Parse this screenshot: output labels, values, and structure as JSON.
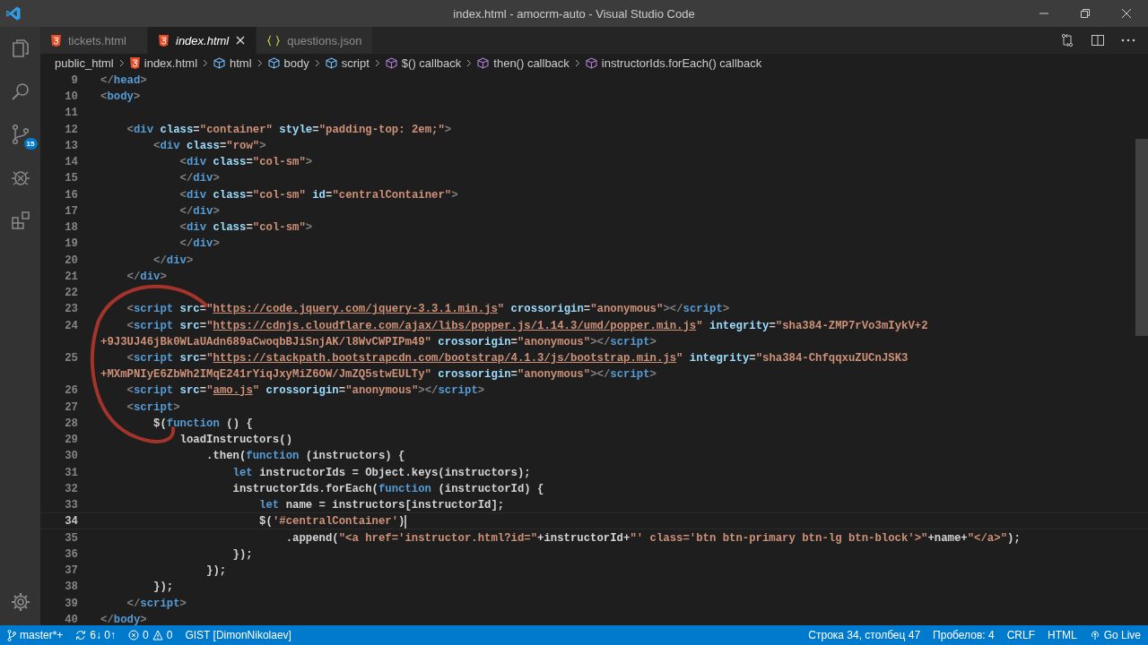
{
  "window": {
    "title": "index.html - amocrm-auto - Visual Studio Code"
  },
  "activity_bar": {
    "source_control_badge": "15"
  },
  "tabs": [
    {
      "label": "tickets.html",
      "kind": "html",
      "selected": false
    },
    {
      "label": "index.html",
      "kind": "html",
      "selected": true
    },
    {
      "label": "questions.json",
      "kind": "json",
      "selected": false
    }
  ],
  "breadcrumb": [
    {
      "label": "public_html",
      "kind": "folder"
    },
    {
      "label": "index.html",
      "kind": "html"
    },
    {
      "label": "html",
      "kind": "element"
    },
    {
      "label": "body",
      "kind": "element"
    },
    {
      "label": "script",
      "kind": "element"
    },
    {
      "label": "$() callback",
      "kind": "method"
    },
    {
      "label": "then() callback",
      "kind": "method"
    },
    {
      "label": "instructorIds.forEach() callback",
      "kind": "method"
    }
  ],
  "editor": {
    "lines": [
      {
        "number": "9",
        "current": false,
        "segments": [
          {
            "kind": "p",
            "text": "</"
          },
          {
            "kind": "tag",
            "text": "head"
          },
          {
            "kind": "p",
            "text": ">"
          }
        ]
      },
      {
        "number": "10",
        "current": false,
        "segments": [
          {
            "kind": "p",
            "text": "<"
          },
          {
            "kind": "tag",
            "text": "body"
          },
          {
            "kind": "p",
            "text": ">"
          }
        ]
      },
      {
        "number": "11",
        "current": false
      },
      {
        "number": "12",
        "current": false,
        "segments": [
          {
            "kind": "p",
            "text": "    <"
          },
          {
            "kind": "tag",
            "text": "div"
          },
          {
            "kind": "attr",
            "text": " class"
          },
          {
            "kind": "txt",
            "text": "="
          },
          {
            "kind": "str",
            "text": "\"container\""
          },
          {
            "kind": "attr",
            "text": " style"
          },
          {
            "kind": "txt",
            "text": "="
          },
          {
            "kind": "str",
            "text": "\"padding-top: 2em;\""
          },
          {
            "kind": "p",
            "text": ">"
          }
        ]
      },
      {
        "number": "13",
        "current": false,
        "segments": [
          {
            "kind": "p",
            "text": "        <"
          },
          {
            "kind": "tag",
            "text": "div"
          },
          {
            "kind": "attr",
            "text": " class"
          },
          {
            "kind": "txt",
            "text": "="
          },
          {
            "kind": "str",
            "text": "\"row\""
          },
          {
            "kind": "p",
            "text": ">"
          }
        ]
      },
      {
        "number": "14",
        "current": false,
        "segments": [
          {
            "kind": "p",
            "text": "            <"
          },
          {
            "kind": "tag",
            "text": "div"
          },
          {
            "kind": "attr",
            "text": " class"
          },
          {
            "kind": "txt",
            "text": "="
          },
          {
            "kind": "str",
            "text": "\"col-sm\""
          },
          {
            "kind": "p",
            "text": ">"
          }
        ]
      },
      {
        "number": "15",
        "current": false,
        "segments": [
          {
            "kind": "p",
            "text": "            </"
          },
          {
            "kind": "tag",
            "text": "div"
          },
          {
            "kind": "p",
            "text": ">"
          }
        ]
      },
      {
        "number": "16",
        "current": false,
        "segments": [
          {
            "kind": "p",
            "text": "            <"
          },
          {
            "kind": "tag",
            "text": "div"
          },
          {
            "kind": "attr",
            "text": " class"
          },
          {
            "kind": "txt",
            "text": "="
          },
          {
            "kind": "str",
            "text": "\"col-sm\""
          },
          {
            "kind": "attr",
            "text": " id"
          },
          {
            "kind": "txt",
            "text": "="
          },
          {
            "kind": "str",
            "text": "\"centralContainer\""
          },
          {
            "kind": "p",
            "text": ">"
          }
        ]
      },
      {
        "number": "17",
        "current": false,
        "segments": [
          {
            "kind": "p",
            "text": "            </"
          },
          {
            "kind": "tag",
            "text": "div"
          },
          {
            "kind": "p",
            "text": ">"
          }
        ]
      },
      {
        "number": "18",
        "current": false,
        "segments": [
          {
            "kind": "p",
            "text": "            <"
          },
          {
            "kind": "tag",
            "text": "div"
          },
          {
            "kind": "attr",
            "text": " class"
          },
          {
            "kind": "txt",
            "text": "="
          },
          {
            "kind": "str",
            "text": "\"col-sm\""
          },
          {
            "kind": "p",
            "text": ">"
          }
        ]
      },
      {
        "number": "19",
        "current": false,
        "segments": [
          {
            "kind": "p",
            "text": "            </"
          },
          {
            "kind": "tag",
            "text": "div"
          },
          {
            "kind": "p",
            "text": ">"
          }
        ]
      },
      {
        "number": "20",
        "current": false,
        "segments": [
          {
            "kind": "p",
            "text": "        </"
          },
          {
            "kind": "tag",
            "text": "div"
          },
          {
            "kind": "p",
            "text": ">"
          }
        ]
      },
      {
        "number": "21",
        "current": false,
        "segments": [
          {
            "kind": "p",
            "text": "    </"
          },
          {
            "kind": "tag",
            "text": "div"
          },
          {
            "kind": "p",
            "text": ">"
          }
        ]
      },
      {
        "number": "22",
        "current": false
      },
      {
        "number": "23",
        "current": false,
        "segments": [
          {
            "kind": "p",
            "text": "    <"
          },
          {
            "kind": "tag",
            "text": "script"
          },
          {
            "kind": "attr",
            "text": " src"
          },
          {
            "kind": "txt",
            "text": "="
          },
          {
            "kind": "str",
            "text": "\""
          },
          {
            "kind": "url",
            "text": "https://code.jquery.com/jquery-3.3.1.min.js"
          },
          {
            "kind": "str",
            "text": "\""
          },
          {
            "kind": "attr",
            "text": " crossorigin"
          },
          {
            "kind": "txt",
            "text": "="
          },
          {
            "kind": "str",
            "text": "\"anonymous\""
          },
          {
            "kind": "p",
            "text": "></"
          },
          {
            "kind": "tag",
            "text": "script"
          },
          {
            "kind": "p",
            "text": ">"
          }
        ]
      },
      {
        "number": "24",
        "current": false,
        "segments": [
          {
            "kind": "p",
            "text": "    <"
          },
          {
            "kind": "tag",
            "text": "script"
          },
          {
            "kind": "attr",
            "text": " src"
          },
          {
            "kind": "txt",
            "text": "="
          },
          {
            "kind": "str",
            "text": "\""
          },
          {
            "kind": "url",
            "text": "https://cdnjs.cloudflare.com/ajax/libs/popper.js/1.14.3/umd/popper.min.js"
          },
          {
            "kind": "str",
            "text": "\""
          },
          {
            "kind": "attr",
            "text": " integrity"
          },
          {
            "kind": "txt",
            "text": "="
          },
          {
            "kind": "str",
            "text": "\"sha384-ZMP7rVo3mIykV+2"
          }
        ]
      },
      {
        "current": false,
        "segments": [
          {
            "kind": "str",
            "text": "+9J3UJ46jBk0WLaUAdn689aCwoqbBJiSnjAK/l8WvCWPIPm49\""
          },
          {
            "kind": "attr",
            "text": " crossorigin"
          },
          {
            "kind": "txt",
            "text": "="
          },
          {
            "kind": "str",
            "text": "\"anonymous\""
          },
          {
            "kind": "p",
            "text": "></"
          },
          {
            "kind": "tag",
            "text": "script"
          },
          {
            "kind": "p",
            "text": ">"
          }
        ]
      },
      {
        "number": "25",
        "current": false,
        "segments": [
          {
            "kind": "p",
            "text": "    <"
          },
          {
            "kind": "tag",
            "text": "script"
          },
          {
            "kind": "attr",
            "text": " src"
          },
          {
            "kind": "txt",
            "text": "="
          },
          {
            "kind": "str",
            "text": "\""
          },
          {
            "kind": "url",
            "text": "https://stackpath.bootstrapcdn.com/bootstrap/4.1.3/js/bootstrap.min.js"
          },
          {
            "kind": "str",
            "text": "\""
          },
          {
            "kind": "attr",
            "text": " integrity"
          },
          {
            "kind": "txt",
            "text": "="
          },
          {
            "kind": "str",
            "text": "\"sha384-ChfqqxuZUCnJSK3"
          }
        ]
      },
      {
        "current": false,
        "segments": [
          {
            "kind": "str",
            "text": "+MXmPNIyE6ZbWh2IMqE241rYiqJxyMiZ6OW/JmZQ5stwEULTy\""
          },
          {
            "kind": "attr",
            "text": " crossorigin"
          },
          {
            "kind": "txt",
            "text": "="
          },
          {
            "kind": "str",
            "text": "\"anonymous\""
          },
          {
            "kind": "p",
            "text": "></"
          },
          {
            "kind": "tag",
            "text": "script"
          },
          {
            "kind": "p",
            "text": ">"
          }
        ]
      },
      {
        "number": "26",
        "current": false,
        "segments": [
          {
            "kind": "p",
            "text": "    <"
          },
          {
            "kind": "tag",
            "text": "script"
          },
          {
            "kind": "attr",
            "text": " src"
          },
          {
            "kind": "txt",
            "text": "="
          },
          {
            "kind": "str",
            "text": "\""
          },
          {
            "kind": "url",
            "text": "amo.js"
          },
          {
            "kind": "str",
            "text": "\""
          },
          {
            "kind": "attr",
            "text": " crossorigin"
          },
          {
            "kind": "txt",
            "text": "="
          },
          {
            "kind": "str",
            "text": "\"anonymous\""
          },
          {
            "kind": "p",
            "text": "></"
          },
          {
            "kind": "tag",
            "text": "script"
          },
          {
            "kind": "p",
            "text": ">"
          }
        ]
      },
      {
        "number": "27",
        "current": false,
        "segments": [
          {
            "kind": "p",
            "text": "    <"
          },
          {
            "kind": "tag",
            "text": "script"
          },
          {
            "kind": "p",
            "text": ">"
          }
        ]
      },
      {
        "number": "28",
        "current": false,
        "segments": [
          {
            "kind": "txt",
            "text": "        $("
          },
          {
            "kind": "kw",
            "text": "function"
          },
          {
            "kind": "txt",
            "text": " () {"
          }
        ]
      },
      {
        "number": "29",
        "current": false,
        "segments": [
          {
            "kind": "txt",
            "text": "            loadInstructors()"
          }
        ]
      },
      {
        "number": "30",
        "current": false,
        "segments": [
          {
            "kind": "txt",
            "text": "                .then("
          },
          {
            "kind": "kw",
            "text": "function"
          },
          {
            "kind": "txt",
            "text": " (instructors) {"
          }
        ]
      },
      {
        "number": "31",
        "current": false,
        "segments": [
          {
            "kind": "kw",
            "text": "                    let"
          },
          {
            "kind": "txt",
            "text": " instructorIds = Object.keys(instructors);"
          }
        ]
      },
      {
        "number": "32",
        "current": false,
        "segments": [
          {
            "kind": "txt",
            "text": "                    instructorIds.forEach("
          },
          {
            "kind": "kw",
            "text": "function"
          },
          {
            "kind": "txt",
            "text": " (instructorId) {"
          }
        ]
      },
      {
        "number": "33",
        "current": false,
        "segments": [
          {
            "kind": "kw",
            "text": "                        let"
          },
          {
            "kind": "txt",
            "text": " name = instructors[instructorId];"
          }
        ]
      },
      {
        "number": "34",
        "current": true,
        "segments": [
          {
            "kind": "txt",
            "text": "                        $("
          },
          {
            "kind": "str",
            "text": "'#centralContainer'"
          },
          {
            "kind": "txt",
            "text": ")"
          }
        ]
      },
      {
        "number": "35",
        "current": false,
        "segments": [
          {
            "kind": "txt",
            "text": "                            .append("
          },
          {
            "kind": "str",
            "text": "\"<a href='instructor.html?id=\""
          },
          {
            "kind": "txt",
            "text": "+instructorId+"
          },
          {
            "kind": "str",
            "text": "\"' class='btn btn-primary btn-lg btn-block'>\""
          },
          {
            "kind": "txt",
            "text": "+name+"
          },
          {
            "kind": "str",
            "text": "\"</a>\""
          },
          {
            "kind": "txt",
            "text": ");"
          }
        ]
      },
      {
        "number": "36",
        "current": false,
        "segments": [
          {
            "kind": "txt",
            "text": "                    });"
          }
        ]
      },
      {
        "number": "37",
        "current": false,
        "segments": [
          {
            "kind": "txt",
            "text": "                });"
          }
        ]
      },
      {
        "number": "38",
        "current": false,
        "segments": [
          {
            "kind": "txt",
            "text": "        });"
          }
        ]
      },
      {
        "number": "39",
        "current": false,
        "segments": [
          {
            "kind": "p",
            "text": "    </"
          },
          {
            "kind": "tag",
            "text": "script"
          },
          {
            "kind": "p",
            "text": ">"
          }
        ]
      },
      {
        "number": "40",
        "current": false,
        "segments": [
          {
            "kind": "p",
            "text": "</"
          },
          {
            "kind": "tag",
            "text": "body"
          },
          {
            "kind": "p",
            "text": ">"
          }
        ]
      }
    ]
  },
  "status_bar": {
    "branch": "master*+",
    "sync": "6↓ 0↑",
    "errors": "0",
    "warnings": "0",
    "gist": "GIST [DimonNikolaev]",
    "right": [
      {
        "label": "Строка 34, столбец 47",
        "kind": "text"
      },
      {
        "label": "Пробелов: 4",
        "kind": "text"
      },
      {
        "label": "CRLF",
        "kind": "text"
      },
      {
        "label": "HTML",
        "kind": "text"
      },
      {
        "label": "Go Live",
        "kind": "live"
      }
    ]
  }
}
